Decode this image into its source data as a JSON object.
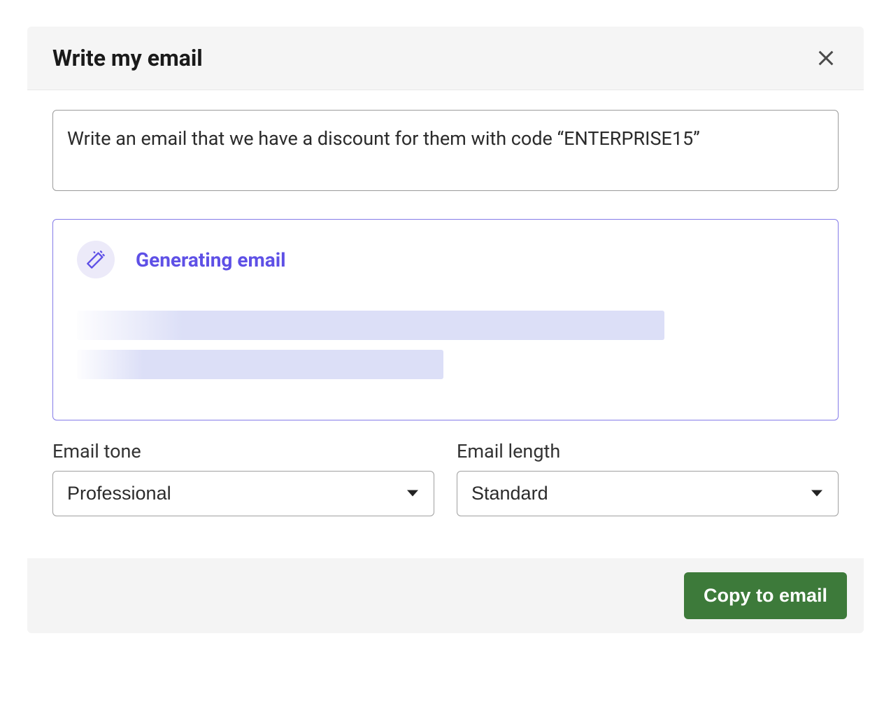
{
  "header": {
    "title": "Write my email"
  },
  "prompt": {
    "value": "Write an email that we have a discount for them with code “ENTERPRISE15”"
  },
  "generation": {
    "status_label": "Generating email"
  },
  "controls": {
    "tone": {
      "label": "Email tone",
      "value": "Professional"
    },
    "length": {
      "label": "Email length",
      "value": "Standard"
    }
  },
  "footer": {
    "copy_label": "Copy to email"
  },
  "colors": {
    "accent": "#5e50e6",
    "primary_button": "#3d7a3a"
  }
}
